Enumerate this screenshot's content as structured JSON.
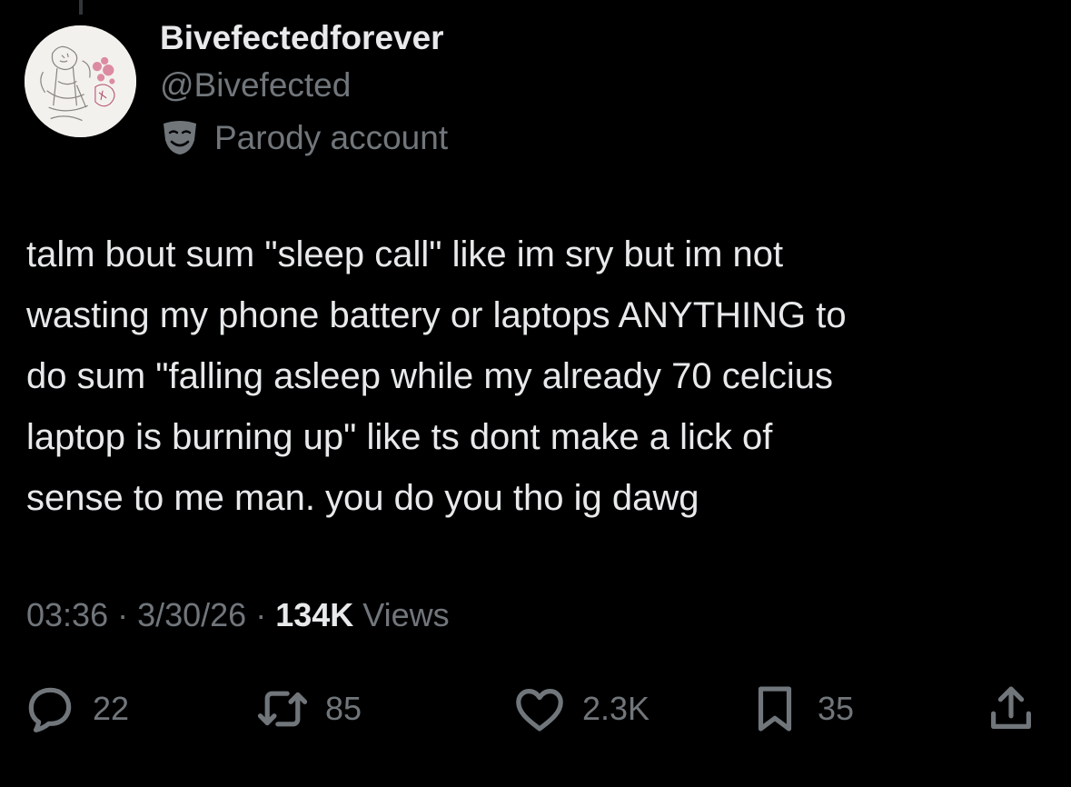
{
  "author": {
    "display_name": "Bivefectedforever",
    "handle": "@Bivefected",
    "label": "Parody account",
    "label_icon": "theater-mask-icon",
    "avatar_icon": "sketch-avatar"
  },
  "tweet": {
    "lines": [
      "talm bout sum \"sleep call\" like im sry but im not",
      "wasting my phone battery or laptops ANYTHING to",
      "do sum \"falling asleep while my already 70 celcius",
      "laptop is burning up\" like ts dont make a lick of",
      "sense to me man. you do you tho ig dawg"
    ]
  },
  "meta": {
    "time": "03:36",
    "separator": " · ",
    "date": "3/30/26",
    "views_count": "134K",
    "views_label": "Views"
  },
  "actions": {
    "replies": "22",
    "reposts": "85",
    "likes": "2.3K",
    "bookmarks": "35"
  },
  "colors": {
    "background": "#000000",
    "primary_text": "#e7e9ea",
    "secondary_text": "#71767b"
  }
}
